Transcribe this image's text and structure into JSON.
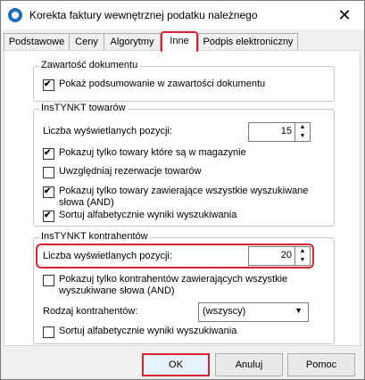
{
  "window": {
    "title": "Korekta faktury wewnętrznej podatku należnego",
    "close_label": "✕"
  },
  "tabs": [
    {
      "label": "Podstawowe"
    },
    {
      "label": "Ceny"
    },
    {
      "label": "Algorytmy"
    },
    {
      "label": "Inne"
    },
    {
      "label": "Podpis elektroniczny"
    }
  ],
  "active_tab": "Inne",
  "groups": {
    "document": {
      "legend": "Zawartość dokumentu",
      "show_summary": {
        "label": "Pokaż podsumowanie w zawartości dokumentu",
        "checked": true
      }
    },
    "instynkt_goods": {
      "legend": "InsTYNKT towarów",
      "count_label": "Liczba wyświetlanych pozycji:",
      "count_value": "15",
      "only_in_stock": {
        "label": "Pokazuj tylko towary które są w magazynie",
        "checked": true
      },
      "include_reservations": {
        "label": "Uwzględniaj rezerwacje towarów",
        "checked": false
      },
      "all_words_line1": "Pokazuj tylko towary zawierające wszystkie wyszukiwane",
      "all_words_line2": "słowa (AND)",
      "all_words_checked": true,
      "sort_alpha": {
        "label": "Sortuj alfabetycznie wyniki wyszukiwania",
        "checked": true
      }
    },
    "instynkt_contractors": {
      "legend": "InsTYNKT kontrahentów",
      "count_label": "Liczba wyświetlanych pozycji:",
      "count_value": "20",
      "all_words_line1": "Pokazuj tylko kontrahentów zawierających wszystkie",
      "all_words_line2": "wyszukiwane słowa (AND)",
      "all_words_checked": false,
      "type_label": "Rodzaj kontrahentów:",
      "type_value": "(wszyscy)",
      "sort_alpha": {
        "label": "Sortuj alfabetycznie wyniki wyszukiwania",
        "checked": false
      }
    }
  },
  "buttons": {
    "ok": "OK",
    "cancel": "Anuluj",
    "help": "Pomoc"
  },
  "colors": {
    "highlight": "#d9232d",
    "accent": "#1e6fc2"
  },
  "icons": {
    "app": "app-logo-icon",
    "spin_up": "▲",
    "spin_down": "▼",
    "dropdown": "▼"
  }
}
